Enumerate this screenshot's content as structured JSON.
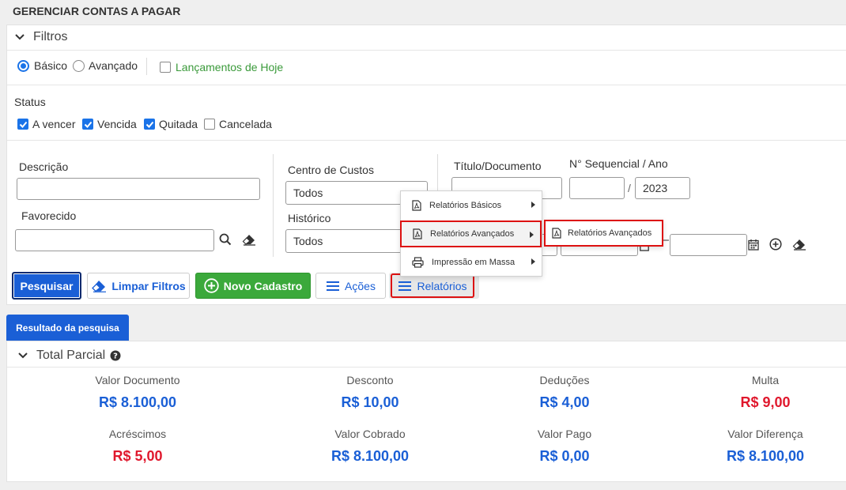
{
  "page": {
    "title": "GERENCIAR CONTAS A PAGAR"
  },
  "filters": {
    "header": "Filtros",
    "mode_basic": "Básico",
    "mode_advanced": "Avançado",
    "today_label": "Lançamentos de Hoje",
    "status_label": "Status",
    "status": [
      {
        "label": "A vencer",
        "checked": true
      },
      {
        "label": "Vencida",
        "checked": true
      },
      {
        "label": "Quitada",
        "checked": true
      },
      {
        "label": "Cancelada",
        "checked": false
      }
    ],
    "descricao_label": "Descrição",
    "favorecido_label": "Favorecido",
    "centro_label": "Centro de Custos",
    "centro_value": "Todos",
    "historico_label": "Histórico",
    "historico_value": "Todos",
    "titulo_label": "Título/Documento",
    "sequencial_label": "N° Sequencial / Ano",
    "slash": "/",
    "year_value": "2023"
  },
  "toolbar": {
    "pesquisar": "Pesquisar",
    "limpar": "Limpar Filtros",
    "novo": "Novo Cadastro",
    "acoes": "Ações",
    "relatorios": "Relatórios"
  },
  "menu": {
    "basicos": "Relatórios Básicos",
    "avancados": "Relatórios Avançados",
    "impressao": "Impressão em Massa",
    "sub_avancados": "Relatórios Avançados"
  },
  "results": {
    "tab": "Resultado da pesquisa",
    "header": "Total Parcial",
    "stats": [
      {
        "label": "Valor Documento",
        "value": "R$ 8.100,00",
        "color": "#1a5fd6"
      },
      {
        "label": "Desconto",
        "value": "R$ 10,00",
        "color": "#1a5fd6"
      },
      {
        "label": "Deduções",
        "value": "R$ 4,00",
        "color": "#1a5fd6"
      },
      {
        "label": "Multa",
        "value": "R$ 9,00",
        "color": "#e0182d"
      },
      {
        "label": "Acréscimos",
        "value": "R$ 5,00",
        "color": "#e0182d"
      },
      {
        "label": "Valor Cobrado",
        "value": "R$ 8.100,00",
        "color": "#1a5fd6"
      },
      {
        "label": "Valor Pago",
        "value": "R$ 0,00",
        "color": "#1a5fd6"
      },
      {
        "label": "Valor Diferença",
        "value": "R$ 8.100,00",
        "color": "#1a5fd6"
      }
    ]
  }
}
